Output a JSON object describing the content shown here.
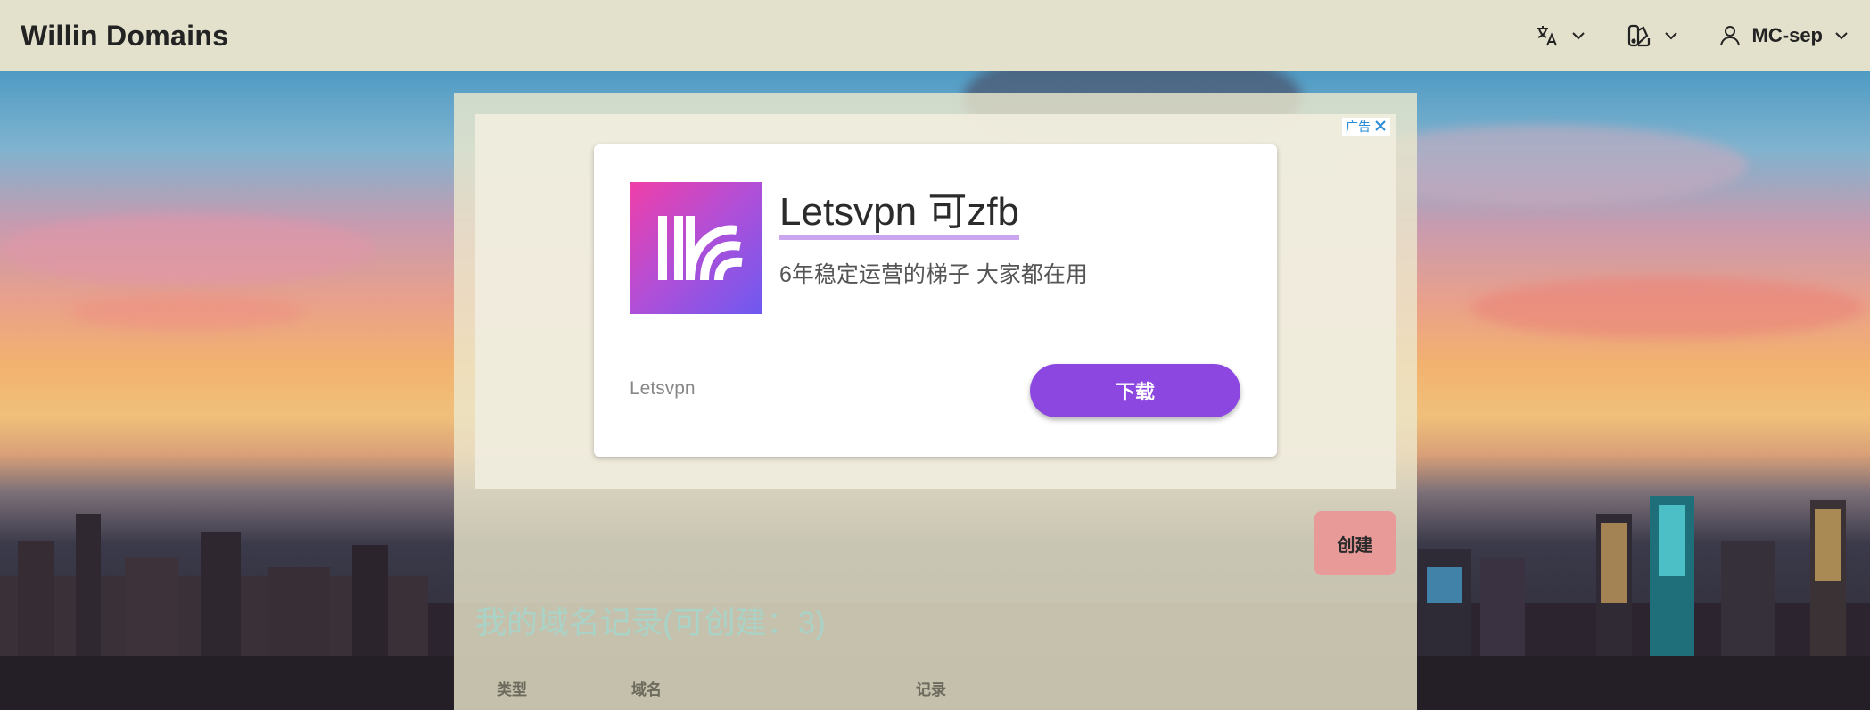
{
  "header": {
    "brand": "Willin Domains",
    "language_icon": "translate-icon",
    "theme_icon": "palette-icon",
    "user_icon": "user-icon",
    "username": "MC-sep"
  },
  "ad": {
    "badge_text": "广告",
    "close_icon": "close-icon",
    "title": "Letsvpn 可zfb",
    "description": "6年稳定运营的梯子 大家都在用",
    "advertiser": "Letsvpn",
    "cta_label": "下载",
    "accent_color": "#8c47e0"
  },
  "main": {
    "create_label": "创建",
    "section_title": "我的域名记录(可创建：3)",
    "columns": [
      "类型",
      "域名",
      "记录"
    ]
  }
}
